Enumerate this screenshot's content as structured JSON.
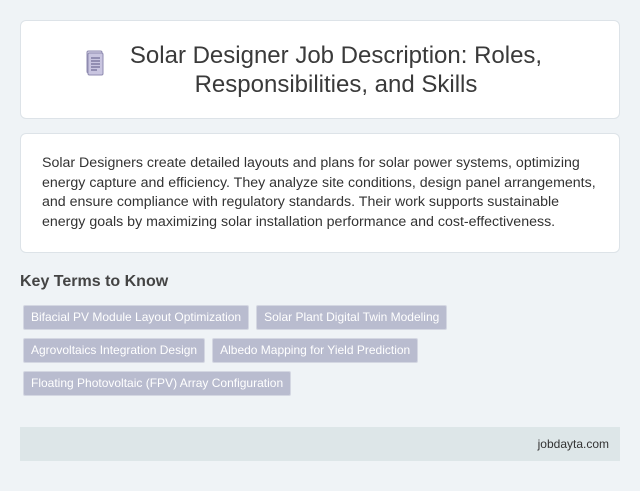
{
  "header": {
    "icon": "document-icon",
    "title": "Solar Designer Job Description: Roles, Responsibilities, and Skills"
  },
  "description": "Solar Designers create detailed layouts and plans for solar power systems, optimizing energy capture and efficiency. They analyze site conditions, design panel arrangements, and ensure compliance with regulatory standards. Their work supports sustainable energy goals by maximizing solar installation performance and cost-effectiveness.",
  "key_terms": {
    "heading": "Key Terms to Know",
    "rows": [
      [
        "Bifacial PV Module Layout Optimization",
        "Solar Plant Digital Twin Modeling"
      ],
      [
        "Agrovoltaics Integration Design",
        "Albedo Mapping for Yield Prediction"
      ],
      [
        "Floating Photovoltaic (FPV) Array Configuration"
      ]
    ]
  },
  "footer": {
    "site": "jobdayta.com"
  },
  "colors": {
    "background": "#eff3f6",
    "chip": "#b9bccf",
    "footer": "#dde6e8"
  }
}
